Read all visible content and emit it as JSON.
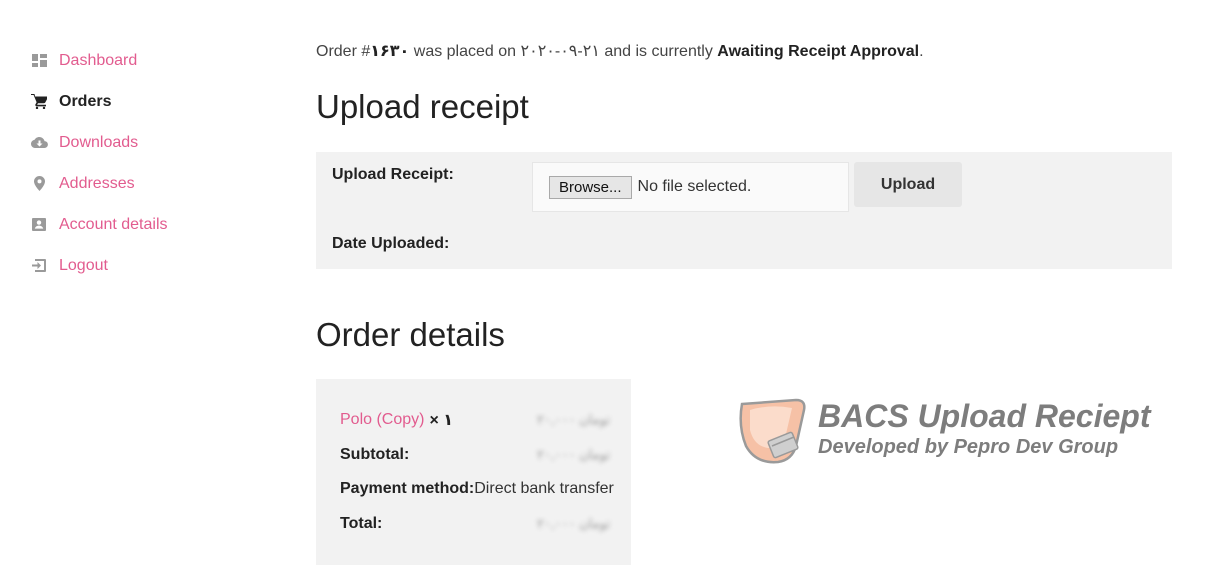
{
  "sidebar": {
    "items": [
      {
        "label": "Dashboard",
        "icon": "dashboard-icon"
      },
      {
        "label": "Orders",
        "icon": "cart-icon",
        "active": true
      },
      {
        "label": "Downloads",
        "icon": "cloud-download-icon"
      },
      {
        "label": "Addresses",
        "icon": "location-pin-icon"
      },
      {
        "label": "Account details",
        "icon": "account-card-icon"
      },
      {
        "label": "Logout",
        "icon": "logout-icon"
      }
    ]
  },
  "notice": {
    "prefix": "Order #",
    "order_number": "۱۶۳۰",
    "middle": " was placed on ",
    "date": "۲۰۲۰-۰۹-۲۱",
    "middle2": " and is currently ",
    "status": "Awaiting Receipt Approval",
    "suffix": "."
  },
  "upload_section": {
    "title": "Upload receipt",
    "upload_label": "Upload Receipt:",
    "browse_label": "Browse...",
    "file_status": "No file selected.",
    "upload_button": "Upload",
    "date_label": "Date Uploaded:"
  },
  "order_details": {
    "title": "Order details",
    "product_name": "Polo (Copy)",
    "product_qty": "× ۱",
    "product_price": "۲۰,۰۰۰ تومان",
    "subtotal_label": "Subtotal:",
    "subtotal_value": "۲۰,۰۰۰ تومان",
    "payment_label": "Payment method:",
    "payment_value": "Direct bank transfer",
    "total_label": "Total:",
    "total_value": "۲۰,۰۰۰ تومان"
  },
  "watermark": {
    "title": "BACS Upload Reciept",
    "subtitle": "Developed by Pepro Dev Group"
  },
  "colors": {
    "accent": "#e25c8f",
    "panel_bg": "#f2f2f2",
    "button_bg": "#e6e6e6",
    "watermark_gray": "#7d7d7d",
    "watermark_peach": "#f6c1a6"
  }
}
